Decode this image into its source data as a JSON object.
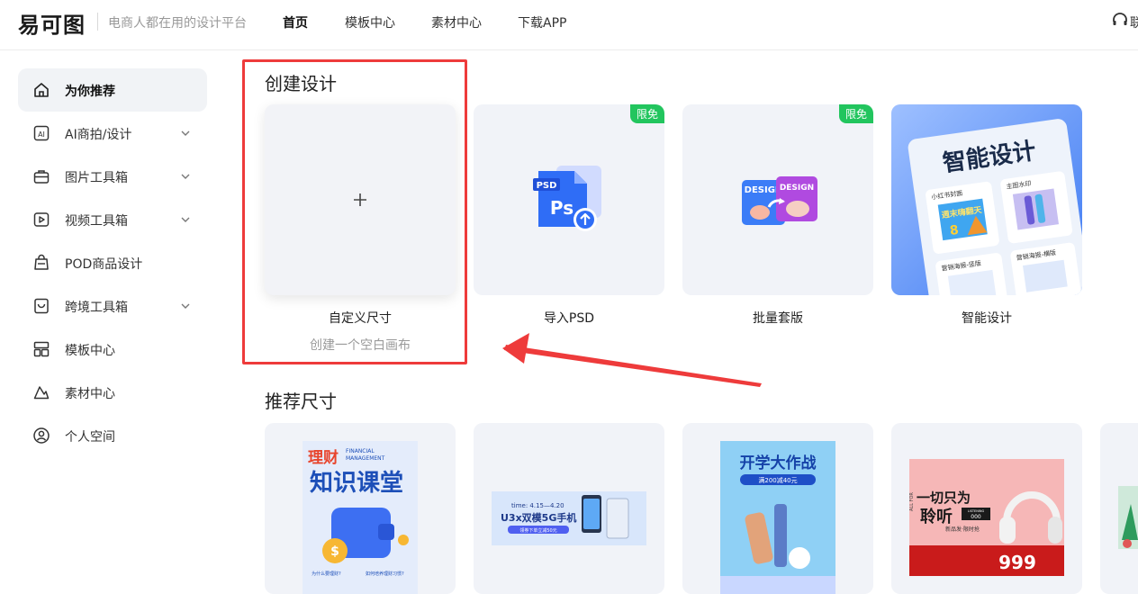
{
  "header": {
    "logo": "易可图",
    "slogan": "电商人都在用的设计平台",
    "nav": [
      "首页",
      "模板中心",
      "素材中心",
      "下载APP"
    ],
    "support_label": "联"
  },
  "sidebar": {
    "items": [
      {
        "label": "为你推荐",
        "icon": "home-icon",
        "active": true
      },
      {
        "label": "AI商拍/设计",
        "icon": "ai-icon",
        "expandable": true
      },
      {
        "label": "图片工具箱",
        "icon": "toolbox-icon",
        "expandable": true
      },
      {
        "label": "视频工具箱",
        "icon": "video-icon",
        "expandable": true
      },
      {
        "label": "POD商品设计",
        "icon": "pod-icon"
      },
      {
        "label": "跨境工具箱",
        "icon": "crossborder-icon",
        "expandable": true
      },
      {
        "label": "模板中心",
        "icon": "template-icon"
      },
      {
        "label": "素材中心",
        "icon": "material-icon"
      },
      {
        "label": "个人空间",
        "icon": "user-icon"
      }
    ]
  },
  "create": {
    "title": "创建设计",
    "cards": [
      {
        "label": "自定义尺寸",
        "sub": "创建一个空白画布"
      },
      {
        "label": "导入PSD",
        "badge": "限免",
        "art": {
          "tag": "PSD",
          "letters": "Ps"
        }
      },
      {
        "label": "批量套版",
        "badge": "限免",
        "art": {
          "tag1": "DESIGN",
          "tag2": "DESIGN"
        }
      },
      {
        "label": "智能设计",
        "art": {
          "headline": "智能设计",
          "items": [
            "小红书封面",
            "主图水印",
            "营销海报-竖版",
            "营销海报-横版"
          ],
          "promo": "週末嗨翻天",
          "promo_price": "8"
        }
      }
    ]
  },
  "recommend": {
    "title": "推荐尺寸",
    "cards": [
      {
        "title_line1": "理财",
        "title_en": "FINANCIAL MANAGEMENT",
        "title_line2": "知识课堂",
        "foot": [
          "为什么要理财?",
          "如何培养理财习惯?"
        ]
      },
      {
        "time": "time: 4.15—4.20",
        "headline": "U3x双模5G手机",
        "sub": "领券下单立减50元"
      },
      {
        "headline": "开学大作战",
        "sub": "满200减40元"
      },
      {
        "headline1": "一切只为",
        "headline2": "聆听",
        "tag": "LISTENING",
        "tag_num": "000",
        "sub": "新品发·限时抢",
        "price": "999",
        "side_text": "ALL FOR"
      }
    ]
  },
  "colors": {
    "accent_green": "#22c55e",
    "highlight_red": "#ee3b3b",
    "psd_blue": "#2f6df6"
  }
}
